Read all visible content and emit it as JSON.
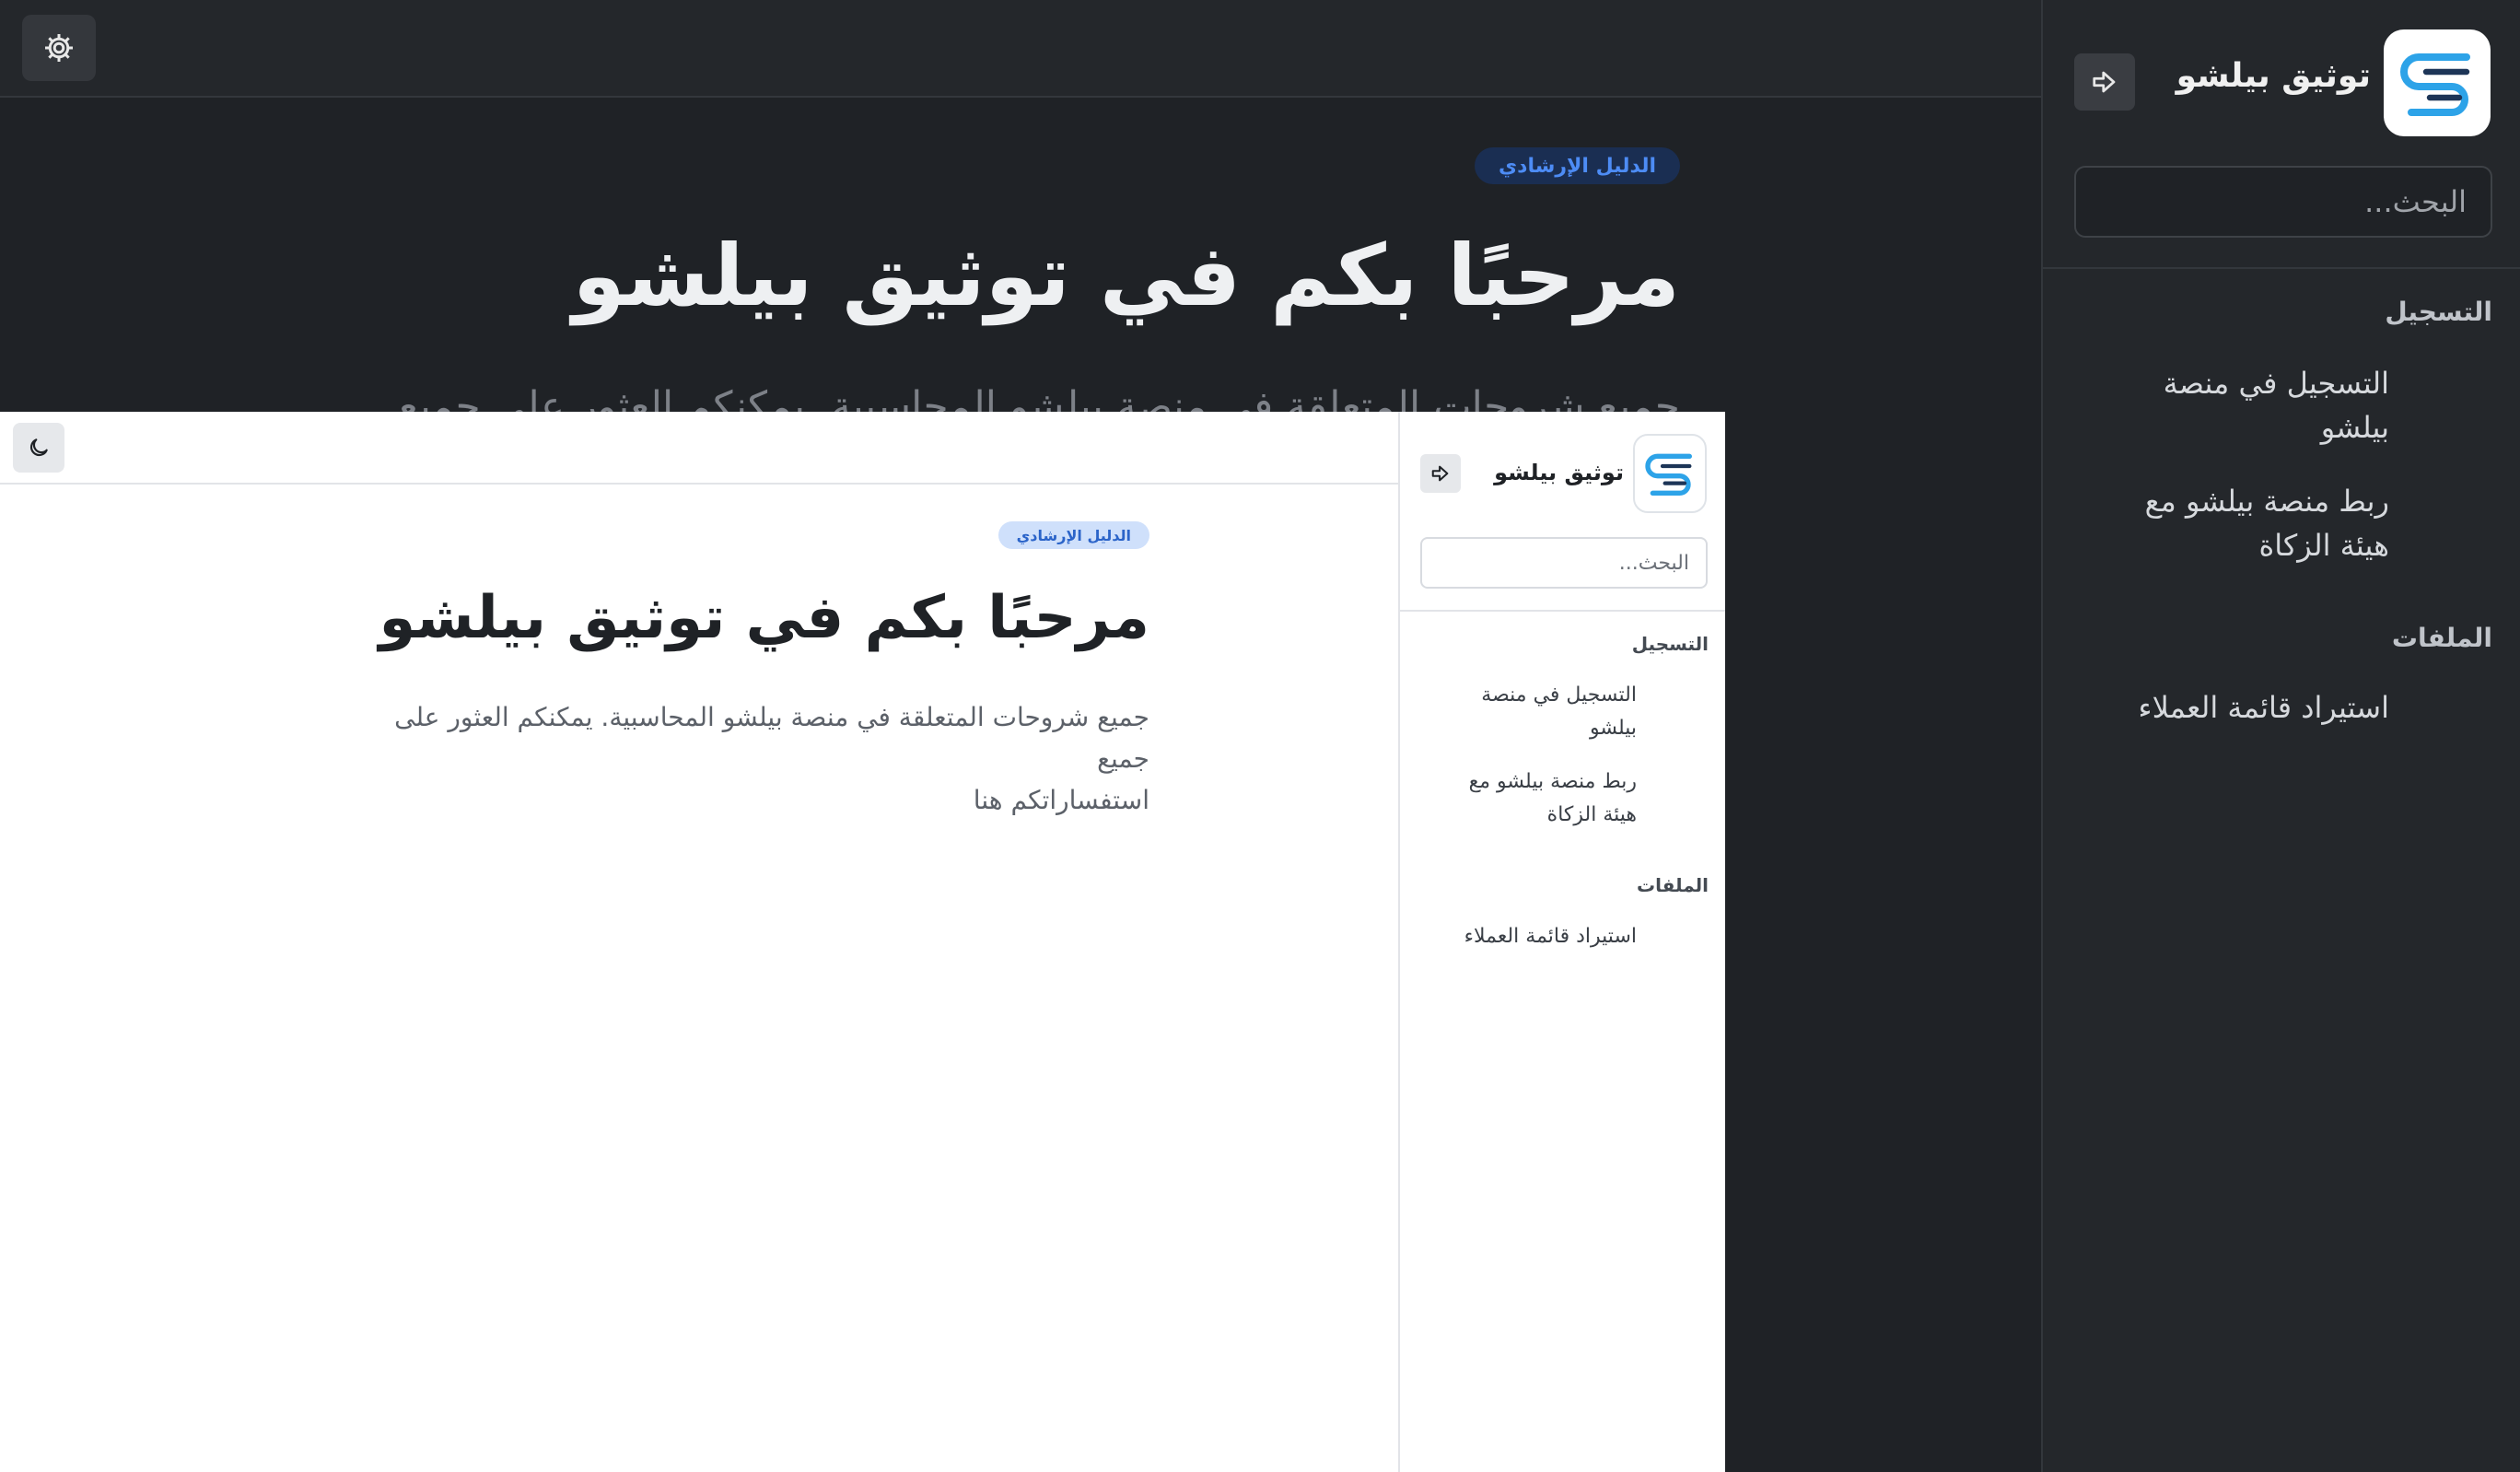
{
  "brand": {
    "name": "توثيق بيلشو",
    "logo_icon": "doc-lines-logo-icon",
    "logo_colors": {
      "dark_line": "#1d3557",
      "accent": "#2da3e8"
    }
  },
  "search": {
    "placeholder": "البحث..."
  },
  "nav": {
    "sections": [
      {
        "title": "التسجيل",
        "items": [
          {
            "label_line1": "التسجيل في منصة",
            "label_line2": "بيلشو"
          },
          {
            "label_line1": "ربط منصة بيلشو مع",
            "label_line2": "هيئة الزكاة"
          }
        ]
      },
      {
        "title": "الملفات",
        "items": [
          {
            "label_line1": "استيراد قائمة العملاء"
          }
        ]
      }
    ]
  },
  "page": {
    "badge": "الدليل الإرشادي",
    "title": "مرحبًا بكم في توثيق بيلشو",
    "subtitle": "جميع شروحات المتعلقة في منصة بيلشو المحاسبية. يمكنكم العثور على جميع",
    "subtitle_line2": "استفساراتكم هنا"
  },
  "toolbar": {
    "dark_theme_icon": "gear-icon",
    "light_theme_icon": "moon-icon",
    "collapse_icon": "arrow-right-icon"
  },
  "colors": {
    "dark_bg": "#1f2226",
    "light_bg": "#ffffff",
    "badge_blue": "#2b64c9",
    "accent": "#2da3e8"
  }
}
